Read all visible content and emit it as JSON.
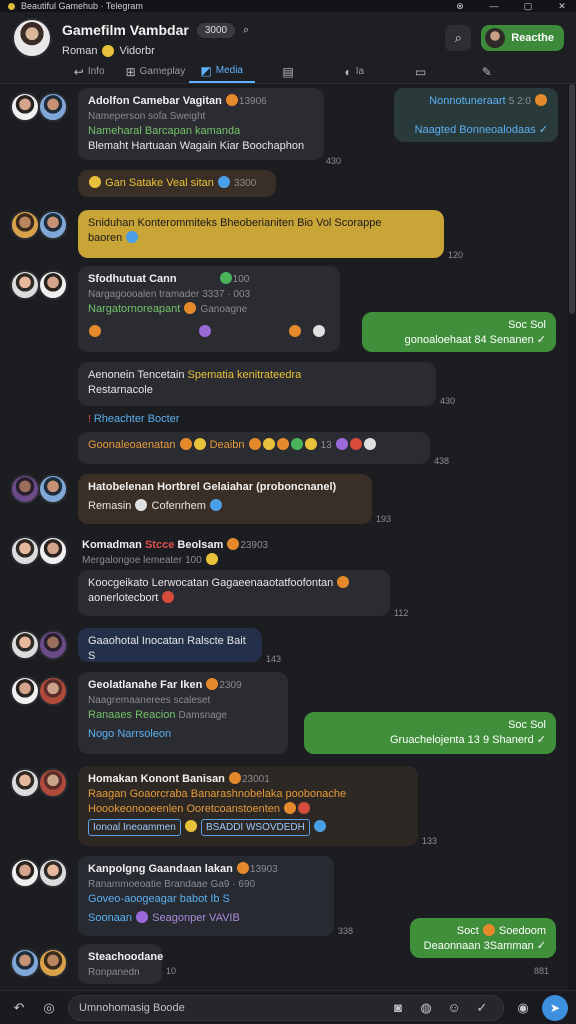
{
  "window": {
    "title": "Beautiful Gamehub · Telegram"
  },
  "header": {
    "title": "Gamefilm Vambdar",
    "subtitle": "Roman",
    "subtitle_extra": "Vidorbr",
    "pill": "3000",
    "button_label": "Reacthe"
  },
  "tabs": [
    {
      "label": "Info",
      "icon": "back-icon"
    },
    {
      "label": "Gameplay",
      "icon": "grid-icon"
    },
    {
      "label": "Media",
      "icon": "image-icon"
    },
    {
      "label": "",
      "icon": "files-icon"
    },
    {
      "label": "Ia",
      "icon": "link-icon"
    },
    {
      "label": "",
      "icon": "screen-icon"
    },
    {
      "label": "",
      "icon": "pen-icon"
    }
  ],
  "messages": [
    {
      "name": "Adolfon Camebar Vagitan",
      "meta": "13906",
      "l1": "Nameperson sofa Sweight",
      "l2": "Nameharal Barcapan kamanda",
      "l3": "Blemaht Hartuaan Wagain Kiar Boochaphon",
      "time": "430"
    },
    {
      "out_l1": "Nonnotuneraart",
      "out_meta": "5 2:0",
      "out_l2": "Naagted Bonneoalodaas",
      "kind": "incoming-teal"
    },
    {
      "text": "Gan Satake Veal sitan",
      "meta": "3300",
      "kind": "brown"
    },
    {
      "text": "Sniduhan Konterommiteks Bheoberianiten Bio Vol Scorappe",
      "text2": "baoren",
      "time": "120",
      "kind": "gold"
    },
    {
      "name": "Sfodhutuat Cann",
      "meta": "100",
      "l1": "Nargagoooalen tramader",
      "l1meta": "3337 · 003",
      "l2": "Nargatornoreapant",
      "l2b": "Ganoagne",
      "time": ""
    },
    {
      "out_l1": "Soc Sol",
      "out_l2": "gonoaloehaat 84 Senanen",
      "kind": "outgoing"
    },
    {
      "text": "Aenonein Tencetain",
      "text_hl": "Spematia kenitrateedra",
      "text2": "Restarnacole",
      "time": "430",
      "kind": "dark"
    },
    {
      "text": "Rheachter Bocter",
      "kind": "link"
    },
    {
      "text": "Goonaleoaenatan",
      "text2": "Deaibn",
      "meta": "13",
      "time": "438",
      "kind": "emoji-row"
    },
    {
      "name": "Hatobelenan",
      "name2": "Hortbrel Gelaiahar (proboncnanel)",
      "text": "Remasin",
      "text2": "Cofenrhem",
      "time": "193",
      "kind": "brown"
    },
    {
      "name": "Komadman",
      "name_red": "Stcce",
      "name3": "Beolsam",
      "meta": "23903",
      "l1": "Mergalongoe lemeater",
      "l1meta": "100",
      "time": ""
    },
    {
      "text": "Koocgeikato Lerwocatan Gagaeenaaotatfoofontan",
      "text2": "aonerlotecbort",
      "time": "112",
      "kind": "dark"
    },
    {
      "text": "Gaaohotal Inocatan Ralscte Bait S",
      "time": "143",
      "kind": "navy"
    },
    {
      "name": "Geolatlanahe Far Iken",
      "meta": "2309",
      "l1": "Naagremaanerees scaleset",
      "l2": "Ranaaes Reacion",
      "l2b": "Damsnage",
      "l3": "Nogo Narrsoleon",
      "time": ""
    },
    {
      "out_l1": "Soc Sol",
      "out_l2": "Gruachelojenta 13 9 Shanerd",
      "kind": "outgoing"
    },
    {
      "name": "Homakan Konont Banisan",
      "meta": "23001",
      "l1": "Raagan Goaorcraba Banarashnobelaka poobonache",
      "l2": "Hoookeonooeenlen Ooretcoanstoenten",
      "l3a": "Ionoal Ineoammen",
      "l3b": "BSADDI WSOVDEDH",
      "time": "133"
    },
    {
      "name": "Kanpolgng Gaandaan lakan",
      "meta": "13903",
      "l1": "Ranammoeoatie Brandaae",
      "l1meta": "Ga9 · 690",
      "l2": "Goveo-aoogeagar babot Ib S",
      "l3": "Soonaan",
      "l3b": "Seagonper VAVIB",
      "time": "338"
    },
    {
      "out_l1": "Soct",
      "out_l1b": "Soedoom",
      "out_l2": "Deaonnaan 3Samman",
      "kind": "outgoing"
    },
    {
      "name": "Steachoodane",
      "l1": "Ronpanedn",
      "time": "10",
      "time2": "881"
    }
  ],
  "composer": {
    "placeholder": "Umnohomasig Boode"
  },
  "colors": {
    "accent": "#5fb2ff",
    "outgoing": "#3f8f3b",
    "gold": "#c9a437",
    "brown": "#3a2f26"
  }
}
